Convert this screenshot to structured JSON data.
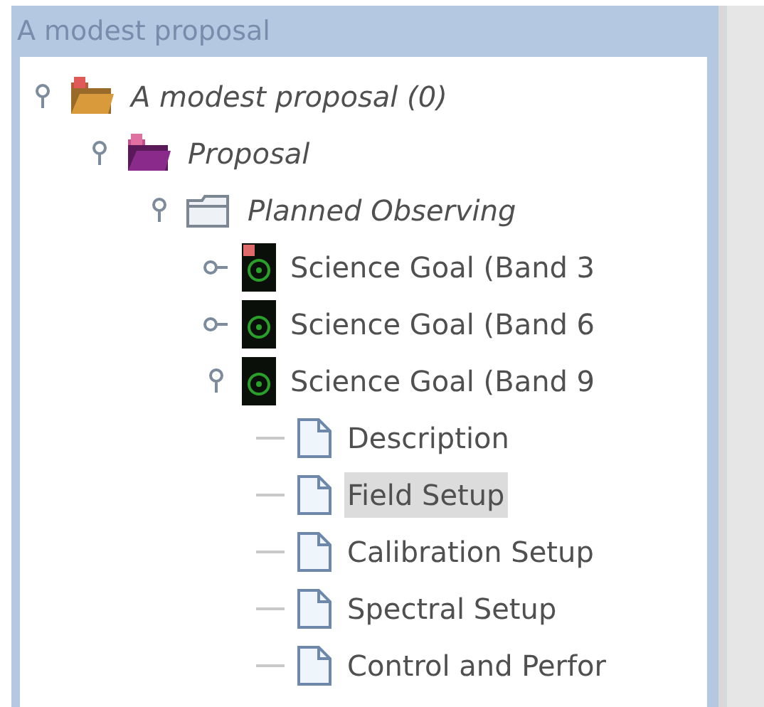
{
  "panel": {
    "title": "A modest proposal"
  },
  "tree": [
    {
      "label": "A modest proposal (0)",
      "kind": "proposal-root",
      "italic": true,
      "expanded": true,
      "selected": false,
      "children": [
        {
          "label": "Proposal",
          "kind": "proposal",
          "italic": true,
          "expanded": true,
          "selected": false,
          "children": [
            {
              "label": "Planned Observing",
              "kind": "folder",
              "italic": true,
              "expanded": true,
              "selected": false,
              "children": [
                {
                  "label": "Science Goal (Band 3",
                  "kind": "goal",
                  "italic": false,
                  "expanded": false,
                  "error": true,
                  "selected": false
                },
                {
                  "label": "Science Goal (Band 6",
                  "kind": "goal",
                  "italic": false,
                  "expanded": false,
                  "error": false,
                  "selected": false
                },
                {
                  "label": "Science Goal (Band 9",
                  "kind": "goal",
                  "italic": false,
                  "expanded": true,
                  "error": false,
                  "selected": false,
                  "children": [
                    {
                      "label": "Description",
                      "kind": "page",
                      "italic": false,
                      "selected": false
                    },
                    {
                      "label": "Field Setup",
                      "kind": "page",
                      "italic": false,
                      "selected": true
                    },
                    {
                      "label": "Calibration Setup",
                      "kind": "page",
                      "italic": false,
                      "selected": false
                    },
                    {
                      "label": "Spectral Setup",
                      "kind": "page",
                      "italic": false,
                      "selected": false
                    },
                    {
                      "label": "Control and Perfor",
                      "kind": "page",
                      "italic": false,
                      "selected": false
                    }
                  ]
                }
              ]
            }
          ]
        }
      ]
    }
  ]
}
